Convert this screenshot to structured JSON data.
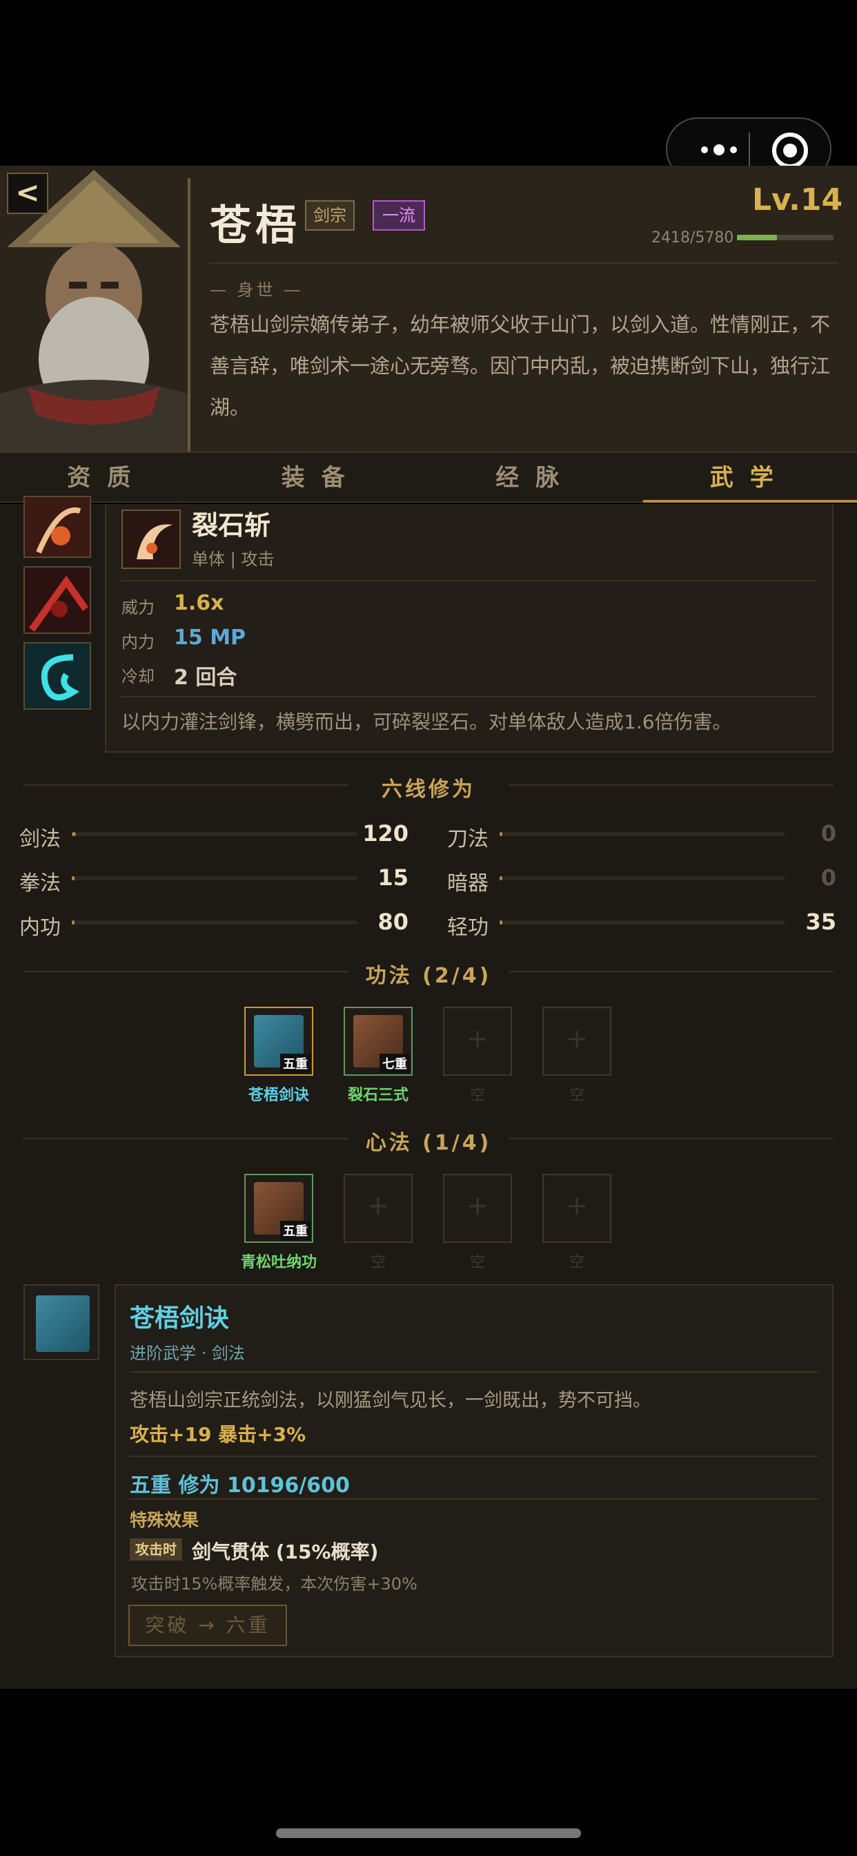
{
  "header": {
    "back_label": "<",
    "name": "苍梧",
    "sect_tag": "剑宗",
    "rank_tag": "一流",
    "level": "Lv.14",
    "exp_text": "2418/5780",
    "exp_progress": 0.42,
    "bio_title": "— 身世 —",
    "bio": "苍梧山剑宗嫡传弟子，幼年被师父收于山门，以剑入道。性情刚正，不善言辞，唯剑术一途心无旁骛。因门中内乱，被迫携断剑下山，独行江湖。"
  },
  "tabs": [
    {
      "label": "资质",
      "active": false
    },
    {
      "label": "装备",
      "active": false
    },
    {
      "label": "经脉",
      "active": false
    },
    {
      "label": "武学",
      "active": true
    }
  ],
  "skill": {
    "name": "裂石斩",
    "type": "单体 | 攻击",
    "stats": [
      {
        "label": "威力",
        "value": "1.6x",
        "color": "#d9b24e"
      },
      {
        "label": "内力",
        "value": "15 MP",
        "color": "#5fa8d8"
      },
      {
        "label": "冷却",
        "value": "2 回合",
        "color": "#d9cfbb"
      }
    ],
    "desc": "以内力灌注剑锋，横劈而出，可碎裂坚石。对单体敌人造成1.6倍伤害。"
  },
  "six_lines": {
    "title": "六线修为",
    "items": [
      {
        "label": "剑法",
        "value": "120",
        "fill": 0.02
      },
      {
        "label": "刀法",
        "value": "0",
        "fill": 0.01
      },
      {
        "label": "拳法",
        "value": "15",
        "fill": 0.01
      },
      {
        "label": "暗器",
        "value": "0",
        "fill": 0.01
      },
      {
        "label": "内功",
        "value": "80",
        "fill": 0.01
      },
      {
        "label": "轻功",
        "value": "35",
        "fill": 0.01
      }
    ]
  },
  "gongfa": {
    "title": "功法 (2/4)",
    "slots": [
      {
        "label": "苍梧剑诀",
        "rank": "五重"
      },
      {
        "label": "裂石三式",
        "rank": "七重"
      },
      {
        "label": "空"
      },
      {
        "label": "空"
      }
    ]
  },
  "xinfa": {
    "title": "心法 (1/4)",
    "slots": [
      {
        "label": "青松吐纳功",
        "rank": "五重"
      },
      {
        "label": "空"
      },
      {
        "label": "空"
      },
      {
        "label": "空"
      }
    ]
  },
  "detail": {
    "name": "苍梧剑诀",
    "sub": "进阶武学 · 剑法",
    "desc": "苍梧山剑宗正统剑法，以刚猛剑气见长，一剑既出，势不可挡。",
    "bonus": "攻击+19  暴击+3%",
    "cultivation": "五重  修为 10196/600",
    "special_title": "特殊效果",
    "trigger_tag": "攻击时",
    "effect_name": "剑气贯体 (15%概率)",
    "effect_desc": "攻击时15%概率触发，本次伤害+30%",
    "break_button": "突破 → 六重"
  }
}
